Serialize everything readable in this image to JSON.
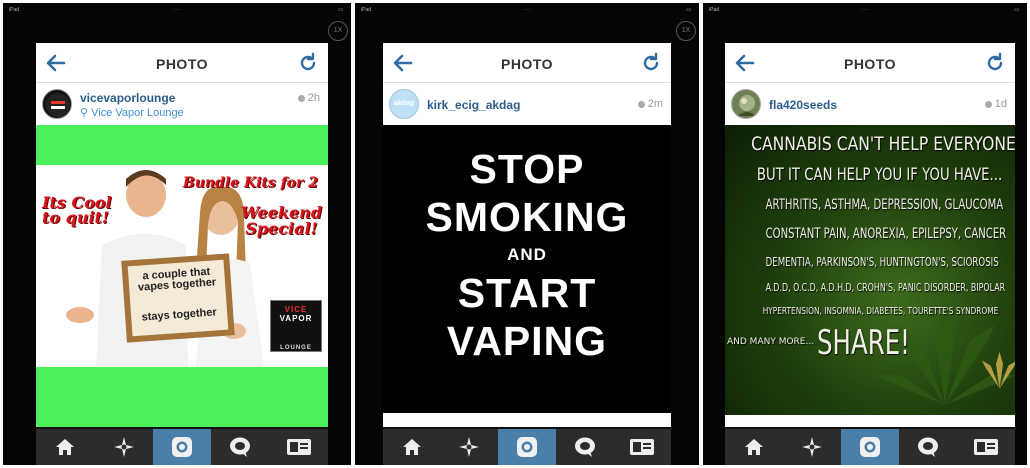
{
  "device_status": {
    "carrier": "iPad",
    "zoom_label": "1X"
  },
  "screens": [
    {
      "header": {
        "title": "PHOTO"
      },
      "user": {
        "username": "vicevaporlounge",
        "location": "Vice Vapor Lounge",
        "time_ago": "2h"
      },
      "post": {
        "left_text": [
          "Its Cool",
          "to quit!"
        ],
        "top_right_text": "Bundle Kits for 2",
        "promo_text": [
          "Weekend",
          "Special!"
        ],
        "sign_text_1": "a couple that vapes together",
        "sign_text_2": "stays together",
        "logo_text": [
          "VICE",
          "VAPOR",
          "LOUNGE"
        ]
      }
    },
    {
      "header": {
        "title": "PHOTO"
      },
      "user": {
        "username": "kirk_ecig_akdag",
        "time_ago": "2m",
        "avatar_text": "akdag"
      },
      "post": {
        "lines": [
          "STOP",
          "SMOKING",
          "AND",
          "START",
          "VAPING"
        ]
      }
    },
    {
      "header": {
        "title": "PHOTO"
      },
      "user": {
        "username": "fla420seeds",
        "time_ago": "1d"
      },
      "post": {
        "lines": [
          "CANNABIS CAN'T HELP EVERYONE",
          "BUT IT CAN HELP YOU IF YOU HAVE...",
          "ARTHRITIS, ASTHMA, DEPRESSION, GLAUCOMA",
          "CONSTANT PAIN, ANOREXIA, EPILEPSY, CANCER",
          "DEMENTIA, PARKINSON'S, HUNTINGTON'S, SCIOROSIS",
          "A.D.D, O.C.D, A.D.H.D, CROHN'S, PANIC DISORDER, BIPOLAR",
          "HYPERTENSION, INSOMNIA, DIABETES, TOURETTE'S SYNDROME",
          "AND MANY MORE...",
          "SHARE!"
        ]
      }
    }
  ],
  "tabbar": {
    "tabs": [
      {
        "icon": "home-icon"
      },
      {
        "icon": "explore-star-icon"
      },
      {
        "icon": "camera-icon",
        "active": true
      },
      {
        "icon": "news-bubble-icon"
      },
      {
        "icon": "profile-card-icon"
      }
    ],
    "active_color": "#4a7faa",
    "background_color": "#2c2c2c"
  },
  "colors": {
    "link_blue": "#2b5d8c",
    "location_blue": "#3f8fd6",
    "promo_red": "#d8151c",
    "green_band": "#4cf05a"
  }
}
